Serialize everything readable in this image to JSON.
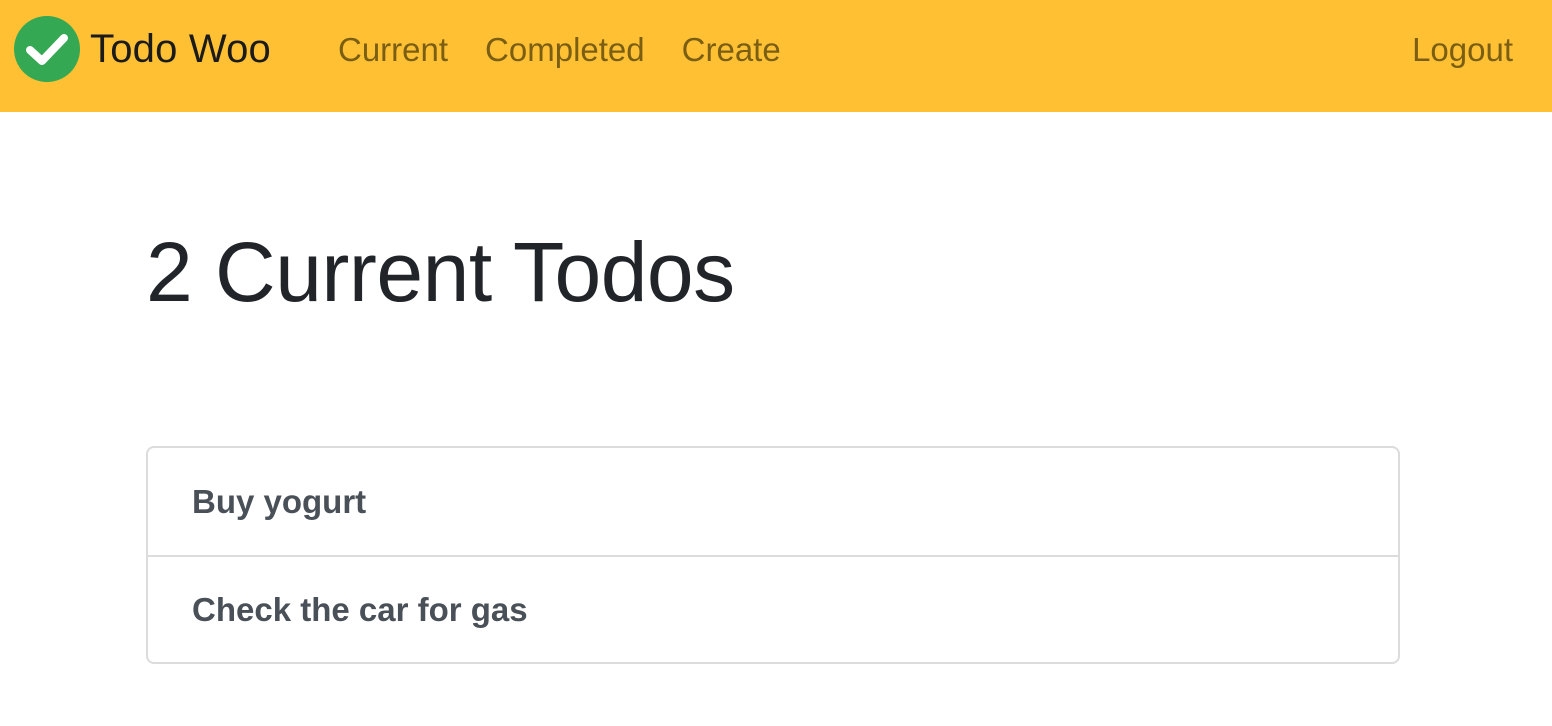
{
  "colors": {
    "navbar_bg": "#ffc133",
    "nav_link": "#7a5e14",
    "logo_green": "#34a853",
    "title_text": "#212529",
    "item_text": "#495057",
    "border": "#dcdcdc"
  },
  "navbar": {
    "brand": {
      "icon": "check-circle-icon",
      "label": "Todo Woo"
    },
    "links": [
      {
        "label": "Current"
      },
      {
        "label": "Completed"
      },
      {
        "label": "Create"
      }
    ],
    "logout_label": "Logout"
  },
  "main": {
    "title": "2 Current Todos",
    "todos": [
      {
        "title": "Buy yogurt"
      },
      {
        "title": "Check the car for gas"
      }
    ]
  }
}
